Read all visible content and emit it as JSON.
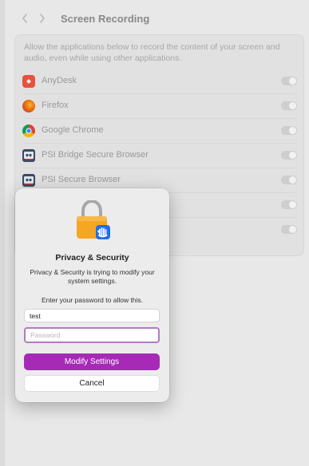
{
  "window": {
    "title": "Screen Recording"
  },
  "panel": {
    "description": "Allow the applications below to record the content of your screen and audio, even while using other applications.",
    "apps": [
      {
        "name": "AnyDesk",
        "icon": "anydesk-icon",
        "enabled": false
      },
      {
        "name": "Firefox",
        "icon": "firefox-icon",
        "enabled": false
      },
      {
        "name": "Google Chrome",
        "icon": "chrome-icon",
        "enabled": false
      },
      {
        "name": "PSI Bridge Secure Browser",
        "icon": "psi-bridge-icon",
        "enabled": false
      },
      {
        "name": "PSI Secure Browser",
        "icon": "psi-secure-browser-icon",
        "enabled": false
      },
      {
        "name": "",
        "icon": "",
        "enabled": false
      },
      {
        "name": "",
        "icon": "",
        "enabled": false
      }
    ]
  },
  "dialog": {
    "title": "Privacy & Security",
    "message": "Privacy & Security is trying to modify your system settings.",
    "prompt": "Enter your password to allow this.",
    "username_value": "test",
    "password_placeholder": "Password",
    "confirm_label": "Modify Settings",
    "cancel_label": "Cancel"
  },
  "colors": {
    "accent": "#a62ab6",
    "focus_ring": "#b07cc1"
  }
}
